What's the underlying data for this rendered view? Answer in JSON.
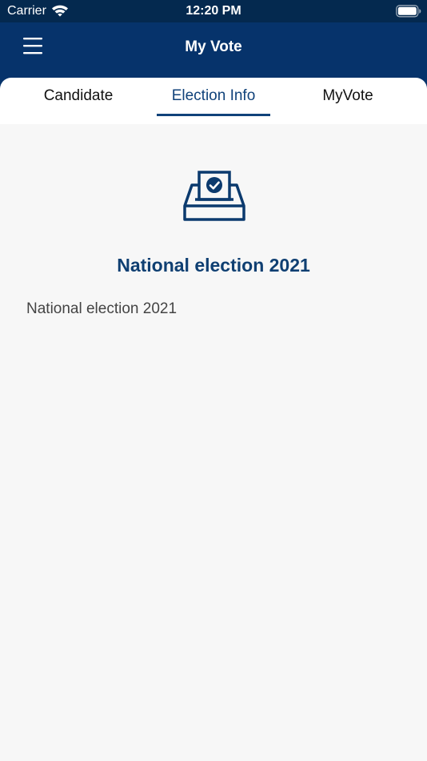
{
  "status_bar": {
    "carrier": "Carrier",
    "time": "12:20 PM",
    "wifi_icon": "wifi-icon",
    "battery_icon": "battery-icon"
  },
  "header": {
    "title": "My Vote",
    "menu_icon": "hamburger-menu-icon",
    "background_color": "#06336b"
  },
  "tabs": [
    {
      "label": "Candidate",
      "active": false
    },
    {
      "label": "Election Info",
      "active": true
    },
    {
      "label": "MyVote",
      "active": false
    }
  ],
  "accent_color": "#10427a",
  "election": {
    "icon": "ballot-box-icon",
    "title": "National election 2021",
    "description": "National election 2021"
  }
}
